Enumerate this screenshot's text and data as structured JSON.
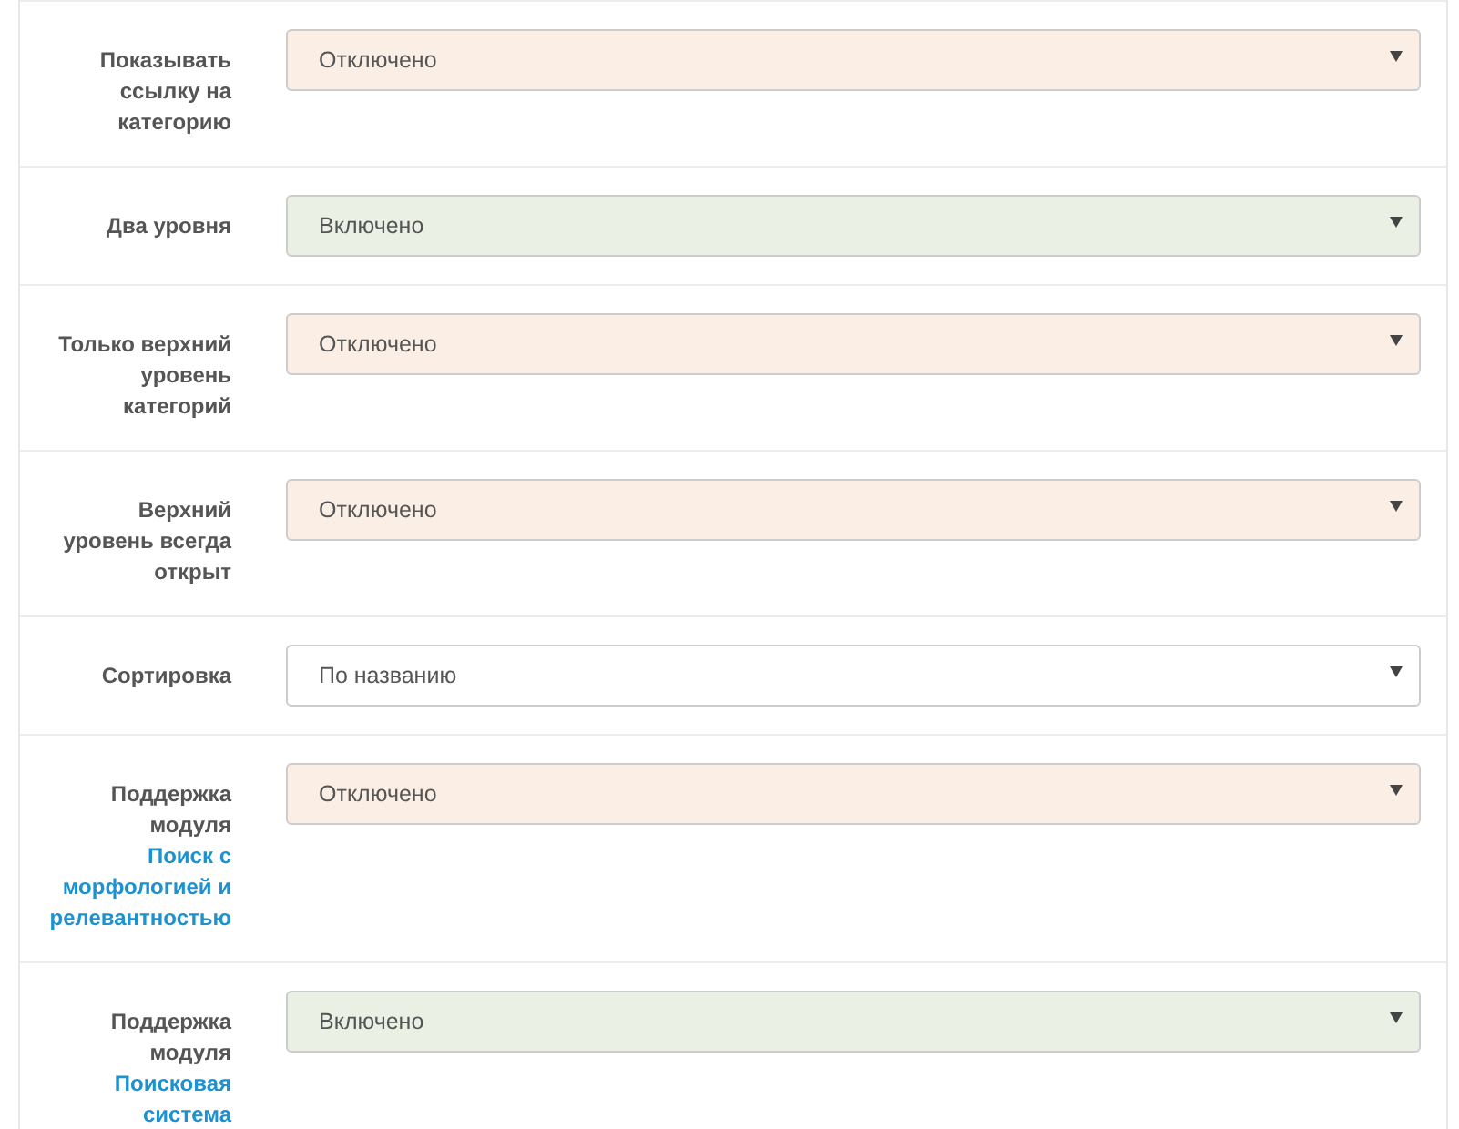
{
  "settings": [
    {
      "label": "Показывать ссылку на категорию",
      "value": "Отключено",
      "kind": "disabled"
    },
    {
      "label": "Два уровня",
      "value": "Включено",
      "kind": "enabled"
    },
    {
      "label": "Только верхний уровень категорий",
      "value": "Отключено",
      "kind": "disabled"
    },
    {
      "label": "Верхний уровень всегда открыт",
      "value": "Отключено",
      "kind": "disabled"
    },
    {
      "label": "Сортировка",
      "value": "По названию",
      "kind": "plain"
    },
    {
      "label": "Поддержка модуля",
      "link": "Поиск с морфологией и релевантностью",
      "value": "Отключено",
      "kind": "disabled"
    },
    {
      "label": "Поддержка модуля",
      "link": "Поисковая система",
      "value": "Включено",
      "kind": "enabled"
    }
  ]
}
